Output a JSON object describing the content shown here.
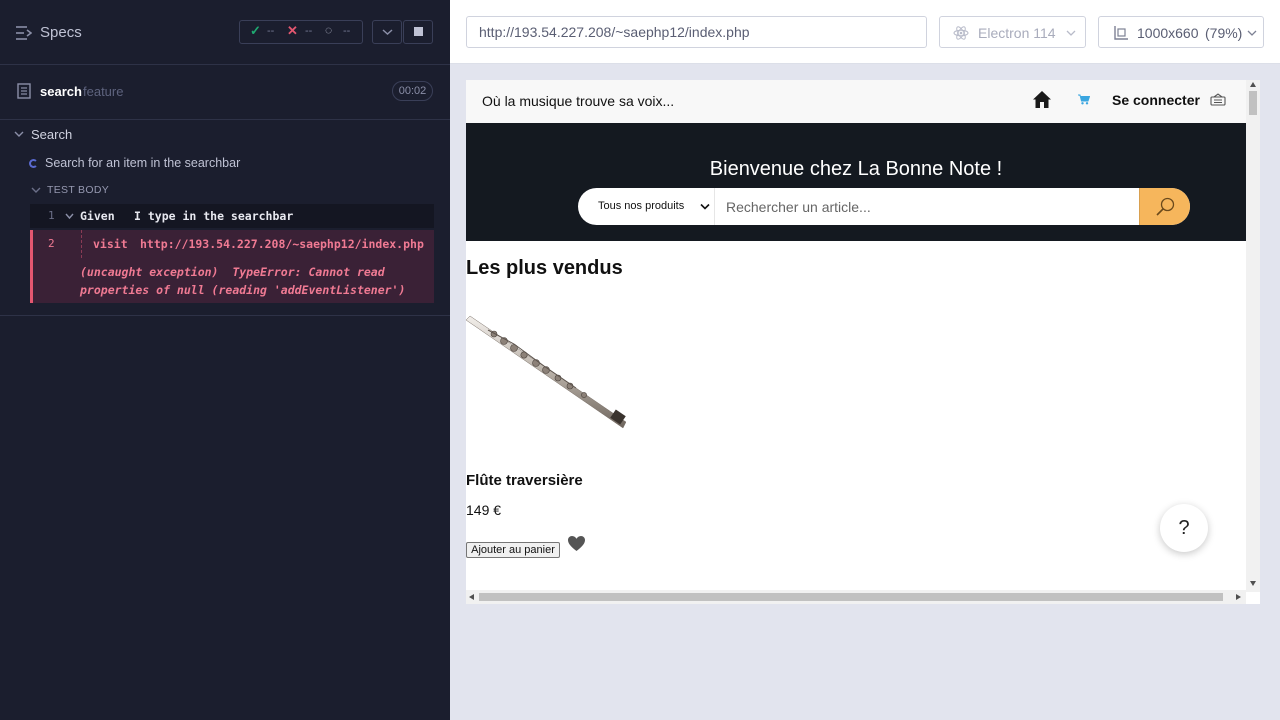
{
  "reporter": {
    "header": {
      "specs_label": "Specs",
      "passed": "--",
      "failed": "--",
      "pending": "--"
    },
    "spec": {
      "name": "search",
      "extension": "feature",
      "duration": "00:02"
    },
    "suite": {
      "label": "Search",
      "test_label": "Search for an item in the searchbar",
      "body_label": "TEST BODY"
    },
    "commands": [
      {
        "number": "1",
        "keyword": "Given",
        "message": "I type in the searchbar"
      },
      {
        "number": "2",
        "keyword": "visit",
        "message": "http://193.54.227.208/~saephp12/index.php"
      }
    ],
    "error": "(uncaught exception)  TypeError: Cannot read\nproperties of null (reading 'addEventListener')"
  },
  "aut": {
    "url": "http://193.54.227.208/~saephp12/index.php",
    "browser": "Electron 114",
    "viewport_size": "1000x660",
    "viewport_zoom": "(79%)"
  },
  "site": {
    "tagline": "Où la musique trouve sa voix...",
    "login": "Se connecter",
    "hero_title": "Bienvenue chez La Bonne Note !",
    "category_selected": "Tous nos produits",
    "search_placeholder": "Rechercher un article...",
    "section_title": "Les plus vendus",
    "product": {
      "name": "Flûte traversière",
      "price": "149 €",
      "add_label": "Ajouter au panier"
    },
    "help_label": "?"
  },
  "colors": {
    "reporter_bg": "#1b1e2e",
    "pass": "#1fa971",
    "fail": "#e45770",
    "search_button": "#f6b65c",
    "hero_bg": "#141920"
  },
  "icons": [
    "specs-icon",
    "check-icon",
    "x-icon",
    "spinner-icon",
    "chevron-down-icon",
    "stop-icon",
    "document-icon",
    "electron-icon",
    "viewport-icon",
    "home-icon",
    "cart-icon",
    "language-icon",
    "search-icon",
    "heart-icon"
  ]
}
